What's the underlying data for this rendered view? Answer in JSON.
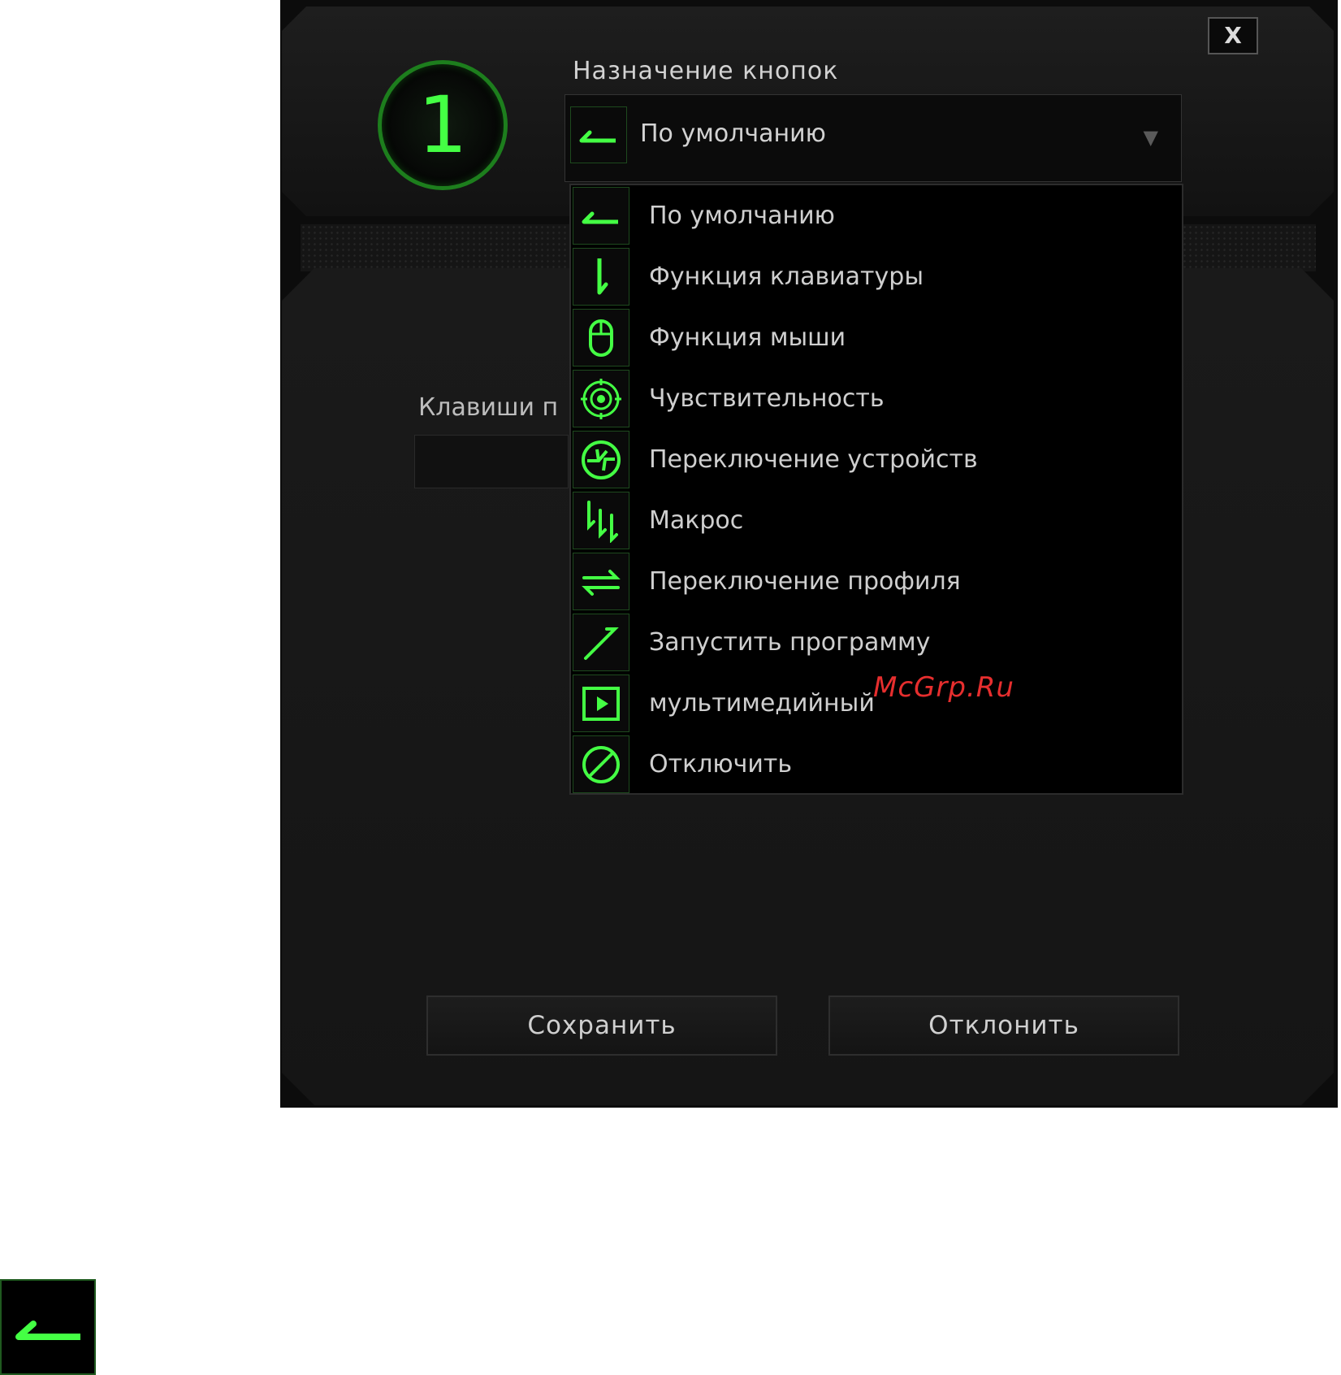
{
  "dialog": {
    "close_label": "X",
    "button_number": "1",
    "section_title": "Назначение кнопок",
    "selected_value": "По умолчанию",
    "keys_label": "Клавиши п",
    "save_label": "Сохранить",
    "cancel_label": "Отклонить"
  },
  "dropdown": {
    "items": [
      {
        "label": "По умолчанию",
        "icon": "default-arrow-icon"
      },
      {
        "label": "Функция клавиатуры",
        "icon": "keyboard-function-icon"
      },
      {
        "label": "Функция мыши",
        "icon": "mouse-icon"
      },
      {
        "label": "Чувствительность",
        "icon": "sensitivity-target-icon"
      },
      {
        "label": "Переключение устройств",
        "icon": "device-switch-icon"
      },
      {
        "label": "Макрос",
        "icon": "macro-icon"
      },
      {
        "label": "Переключение профиля",
        "icon": "profile-switch-icon"
      },
      {
        "label": "Запустить программу",
        "icon": "launch-program-icon"
      },
      {
        "label": "мультимедийный",
        "icon": "multimedia-icon"
      },
      {
        "label": "Отключить",
        "icon": "disable-icon"
      }
    ]
  },
  "watermark": "McGrp.Ru",
  "colors": {
    "accent_green": "#44ff44",
    "background": "#0c0c0c",
    "watermark_red": "#ff3434"
  }
}
